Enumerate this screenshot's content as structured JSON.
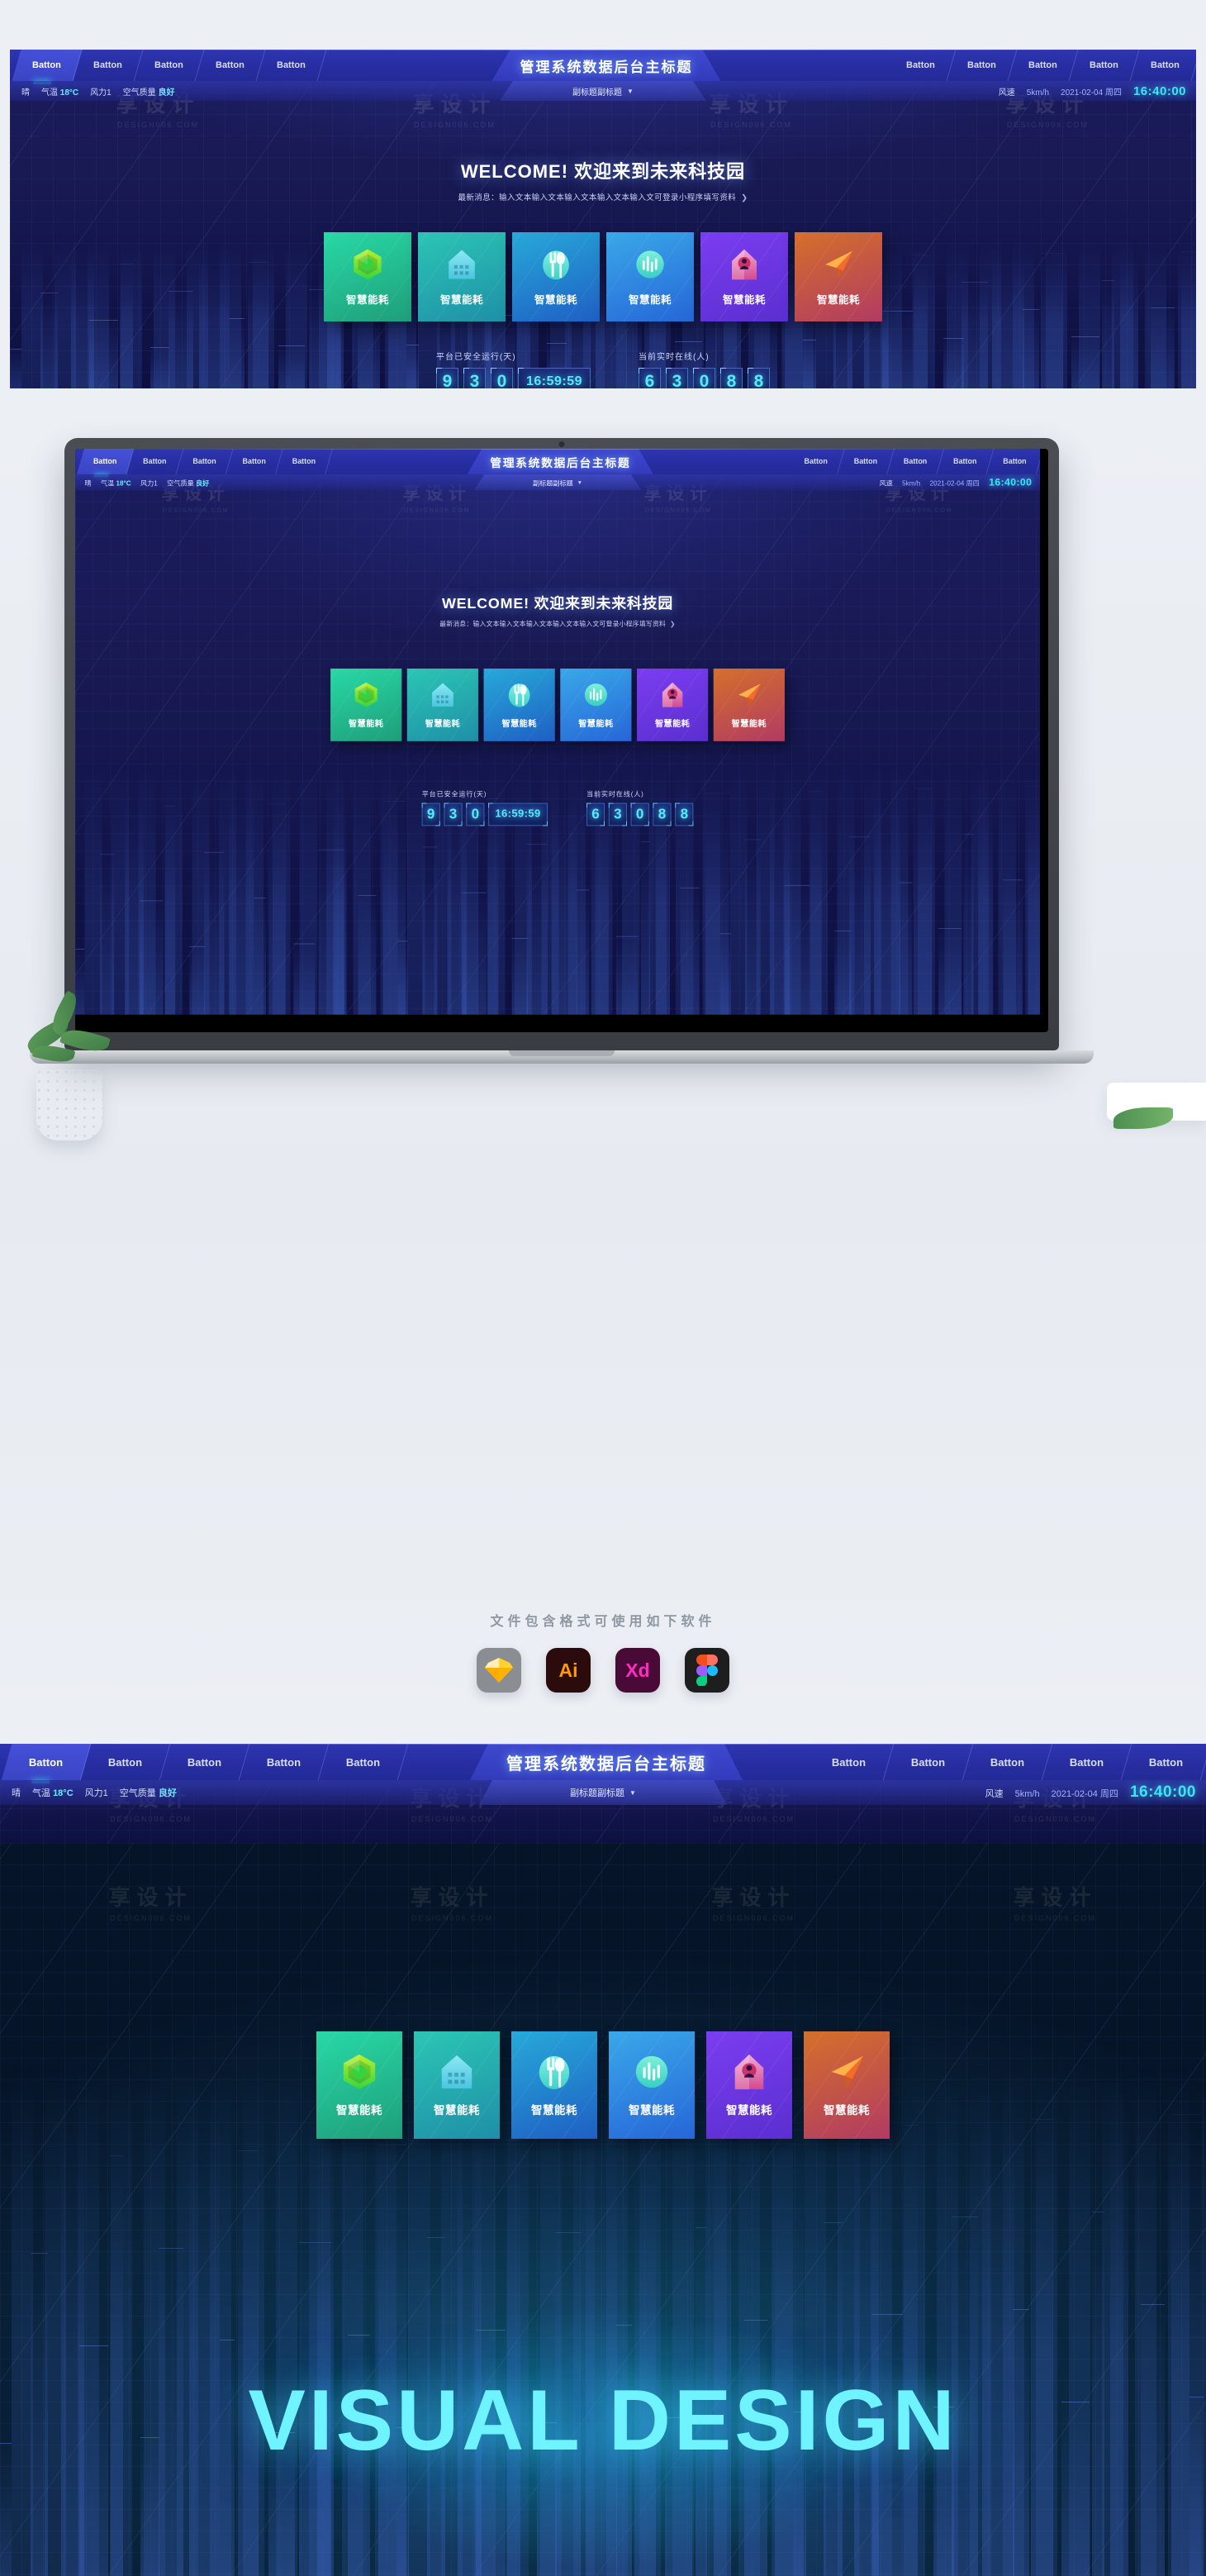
{
  "header": {
    "nav_left": [
      {
        "label": "Batton",
        "active": true
      },
      {
        "label": "Batton",
        "active": false
      },
      {
        "label": "Batton",
        "active": false
      },
      {
        "label": "Batton",
        "active": false
      },
      {
        "label": "Batton",
        "active": false
      }
    ],
    "title": "管理系统数据后台主标题",
    "nav_right": [
      {
        "label": "Batton"
      },
      {
        "label": "Batton"
      },
      {
        "label": "Batton"
      },
      {
        "label": "Batton"
      },
      {
        "label": "Batton"
      }
    ],
    "subtitle": "副标题副标题",
    "subtitle_caret": "▼",
    "weather": {
      "condition": "晴",
      "temp_label": "气温",
      "temp_value": "18°C",
      "wind_label": "风力1",
      "air_label": "空气质量",
      "air_value": "良好"
    },
    "status_right": {
      "wind_speed_label": "风速",
      "wind_speed_value": "5km/h",
      "date": "2021-02-04 周四",
      "clock": "16:40:00"
    }
  },
  "hero": {
    "welcome_title": "WELCOME! 欢迎来到未来科技园",
    "news_prefix": "最新消息：",
    "news_text": "输入文本输入文本输入文本输入文本输入文可登录小程序填写资料",
    "news_arrow": "❯"
  },
  "cards": [
    {
      "label": "智慧能耗",
      "icon": "hexagon-cube-icon",
      "from": "#28d9a5",
      "to": "#1f9e7a",
      "icon_from": "#b8f02a",
      "icon_to": "#35d43f"
    },
    {
      "label": "智慧能耗",
      "icon": "house-building-icon",
      "from": "#2bc6b4",
      "to": "#1f8fa8",
      "icon_from": "#8de8f5",
      "icon_to": "#49c6e0"
    },
    {
      "label": "智慧能耗",
      "icon": "fork-spoon-icon",
      "from": "#27a9d8",
      "to": "#1f5fc4",
      "icon_from": "#7ff0e0",
      "icon_to": "#3fd0c8"
    },
    {
      "label": "智慧能耗",
      "icon": "bar-chart-circle-icon",
      "from": "#3aa8e8",
      "to": "#2666d8",
      "icon_from": "#7df0d8",
      "icon_to": "#37cfc4"
    },
    {
      "label": "智慧能耗",
      "icon": "home-person-icon",
      "from": "#7b3df0",
      "to": "#5a2fd0",
      "icon_from": "#f0a8d8",
      "icon_to": "#d44a8f"
    },
    {
      "label": "智慧能耗",
      "icon": "paper-plane-icon",
      "from": "#d4702a",
      "to": "#b23a63",
      "icon_from": "#ffb24a",
      "icon_to": "#f46b2a"
    }
  ],
  "counters": [
    {
      "title": "平台已安全运行(天)",
      "digits": [
        "9",
        "3",
        "0"
      ],
      "time": "16:59:59"
    },
    {
      "title": "当前实时在线(人)",
      "digits": [
        "6",
        "3",
        "0",
        "8",
        "8"
      ],
      "time": null
    }
  ],
  "formats": {
    "title": "文件包含格式可使用如下软件",
    "apps": [
      {
        "name": "sketch-app-icon",
        "label": ""
      },
      {
        "name": "illustrator-app-icon",
        "label": "Ai"
      },
      {
        "name": "xd-app-icon",
        "label": "Xd"
      },
      {
        "name": "figma-app-icon",
        "label": ""
      }
    ]
  },
  "bottom_banner": {
    "headline": "VISUAL DESIGN"
  },
  "watermark": {
    "zh": "享设计",
    "en": "DESIGN006.COM"
  }
}
